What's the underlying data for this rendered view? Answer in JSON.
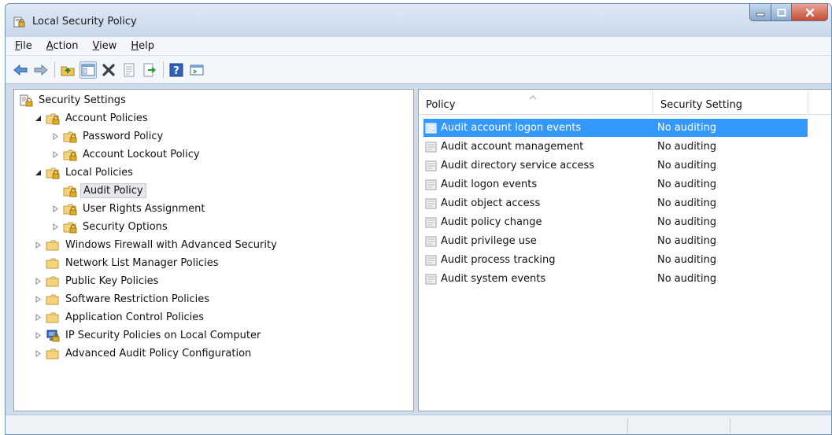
{
  "window": {
    "title": "Local Security Policy",
    "icon": "security-policy-icon",
    "controls": [
      "minimize-icon",
      "maximize-icon",
      "close-icon"
    ]
  },
  "menu": [
    {
      "label": "File",
      "mnemonic": "F",
      "rest": "ile"
    },
    {
      "label": "Action",
      "mnemonic": "A",
      "rest": "ction"
    },
    {
      "label": "View",
      "mnemonic": "V",
      "rest": "iew"
    },
    {
      "label": "Help",
      "mnemonic": "H",
      "rest": "elp"
    }
  ],
  "toolbar": [
    "back-icon",
    "forward-icon",
    "up-folder-icon",
    "show-hide-tree-icon",
    "delete-icon",
    "properties-icon",
    "export-list-icon",
    "help-icon",
    "console-icon"
  ],
  "tree": [
    {
      "label": "Security Settings",
      "level": 0,
      "expander": "none",
      "icon": "security-settings-icon"
    },
    {
      "label": "Account Policies",
      "level": 1,
      "expander": "expanded",
      "icon": "policy-folder-icon"
    },
    {
      "label": "Password Policy",
      "level": 2,
      "expander": "collapsed",
      "icon": "policy-folder-icon"
    },
    {
      "label": "Account Lockout Policy",
      "level": 2,
      "expander": "collapsed",
      "icon": "policy-folder-icon"
    },
    {
      "label": "Local Policies",
      "level": 1,
      "expander": "expanded",
      "icon": "policy-folder-icon"
    },
    {
      "label": "Audit Policy",
      "level": 2,
      "expander": "none",
      "icon": "policy-folder-icon",
      "selected": true
    },
    {
      "label": "User Rights Assignment",
      "level": 2,
      "expander": "collapsed",
      "icon": "policy-folder-icon"
    },
    {
      "label": "Security Options",
      "level": 2,
      "expander": "collapsed",
      "icon": "policy-folder-icon"
    },
    {
      "label": "Windows Firewall with Advanced Security",
      "level": 1,
      "expander": "collapsed",
      "icon": "folder-icon"
    },
    {
      "label": "Network List Manager Policies",
      "level": 1,
      "expander": "none",
      "icon": "folder-icon"
    },
    {
      "label": "Public Key Policies",
      "level": 1,
      "expander": "collapsed",
      "icon": "folder-icon"
    },
    {
      "label": "Software Restriction Policies",
      "level": 1,
      "expander": "collapsed",
      "icon": "folder-icon"
    },
    {
      "label": "Application Control Policies",
      "level": 1,
      "expander": "collapsed",
      "icon": "folder-icon"
    },
    {
      "label": "IP Security Policies on Local Computer",
      "level": 1,
      "expander": "collapsed",
      "icon": "ip-security-icon"
    },
    {
      "label": "Advanced Audit Policy Configuration",
      "level": 1,
      "expander": "collapsed",
      "icon": "folder-icon"
    }
  ],
  "list": {
    "columns": {
      "policy": "Policy",
      "setting": "Security Setting"
    },
    "rows": [
      {
        "policy": "Audit account logon events",
        "setting": "No auditing",
        "selected": true
      },
      {
        "policy": "Audit account management",
        "setting": "No auditing"
      },
      {
        "policy": "Audit directory service access",
        "setting": "No auditing"
      },
      {
        "policy": "Audit logon events",
        "setting": "No auditing"
      },
      {
        "policy": "Audit object access",
        "setting": "No auditing"
      },
      {
        "policy": "Audit policy change",
        "setting": "No auditing"
      },
      {
        "policy": "Audit privilege use",
        "setting": "No auditing"
      },
      {
        "policy": "Audit process tracking",
        "setting": "No auditing"
      },
      {
        "policy": "Audit system events",
        "setting": "No auditing"
      }
    ]
  },
  "colors": {
    "selection": "#3399ff",
    "folder": "#f2cf6d",
    "lock": "#d4a020"
  }
}
